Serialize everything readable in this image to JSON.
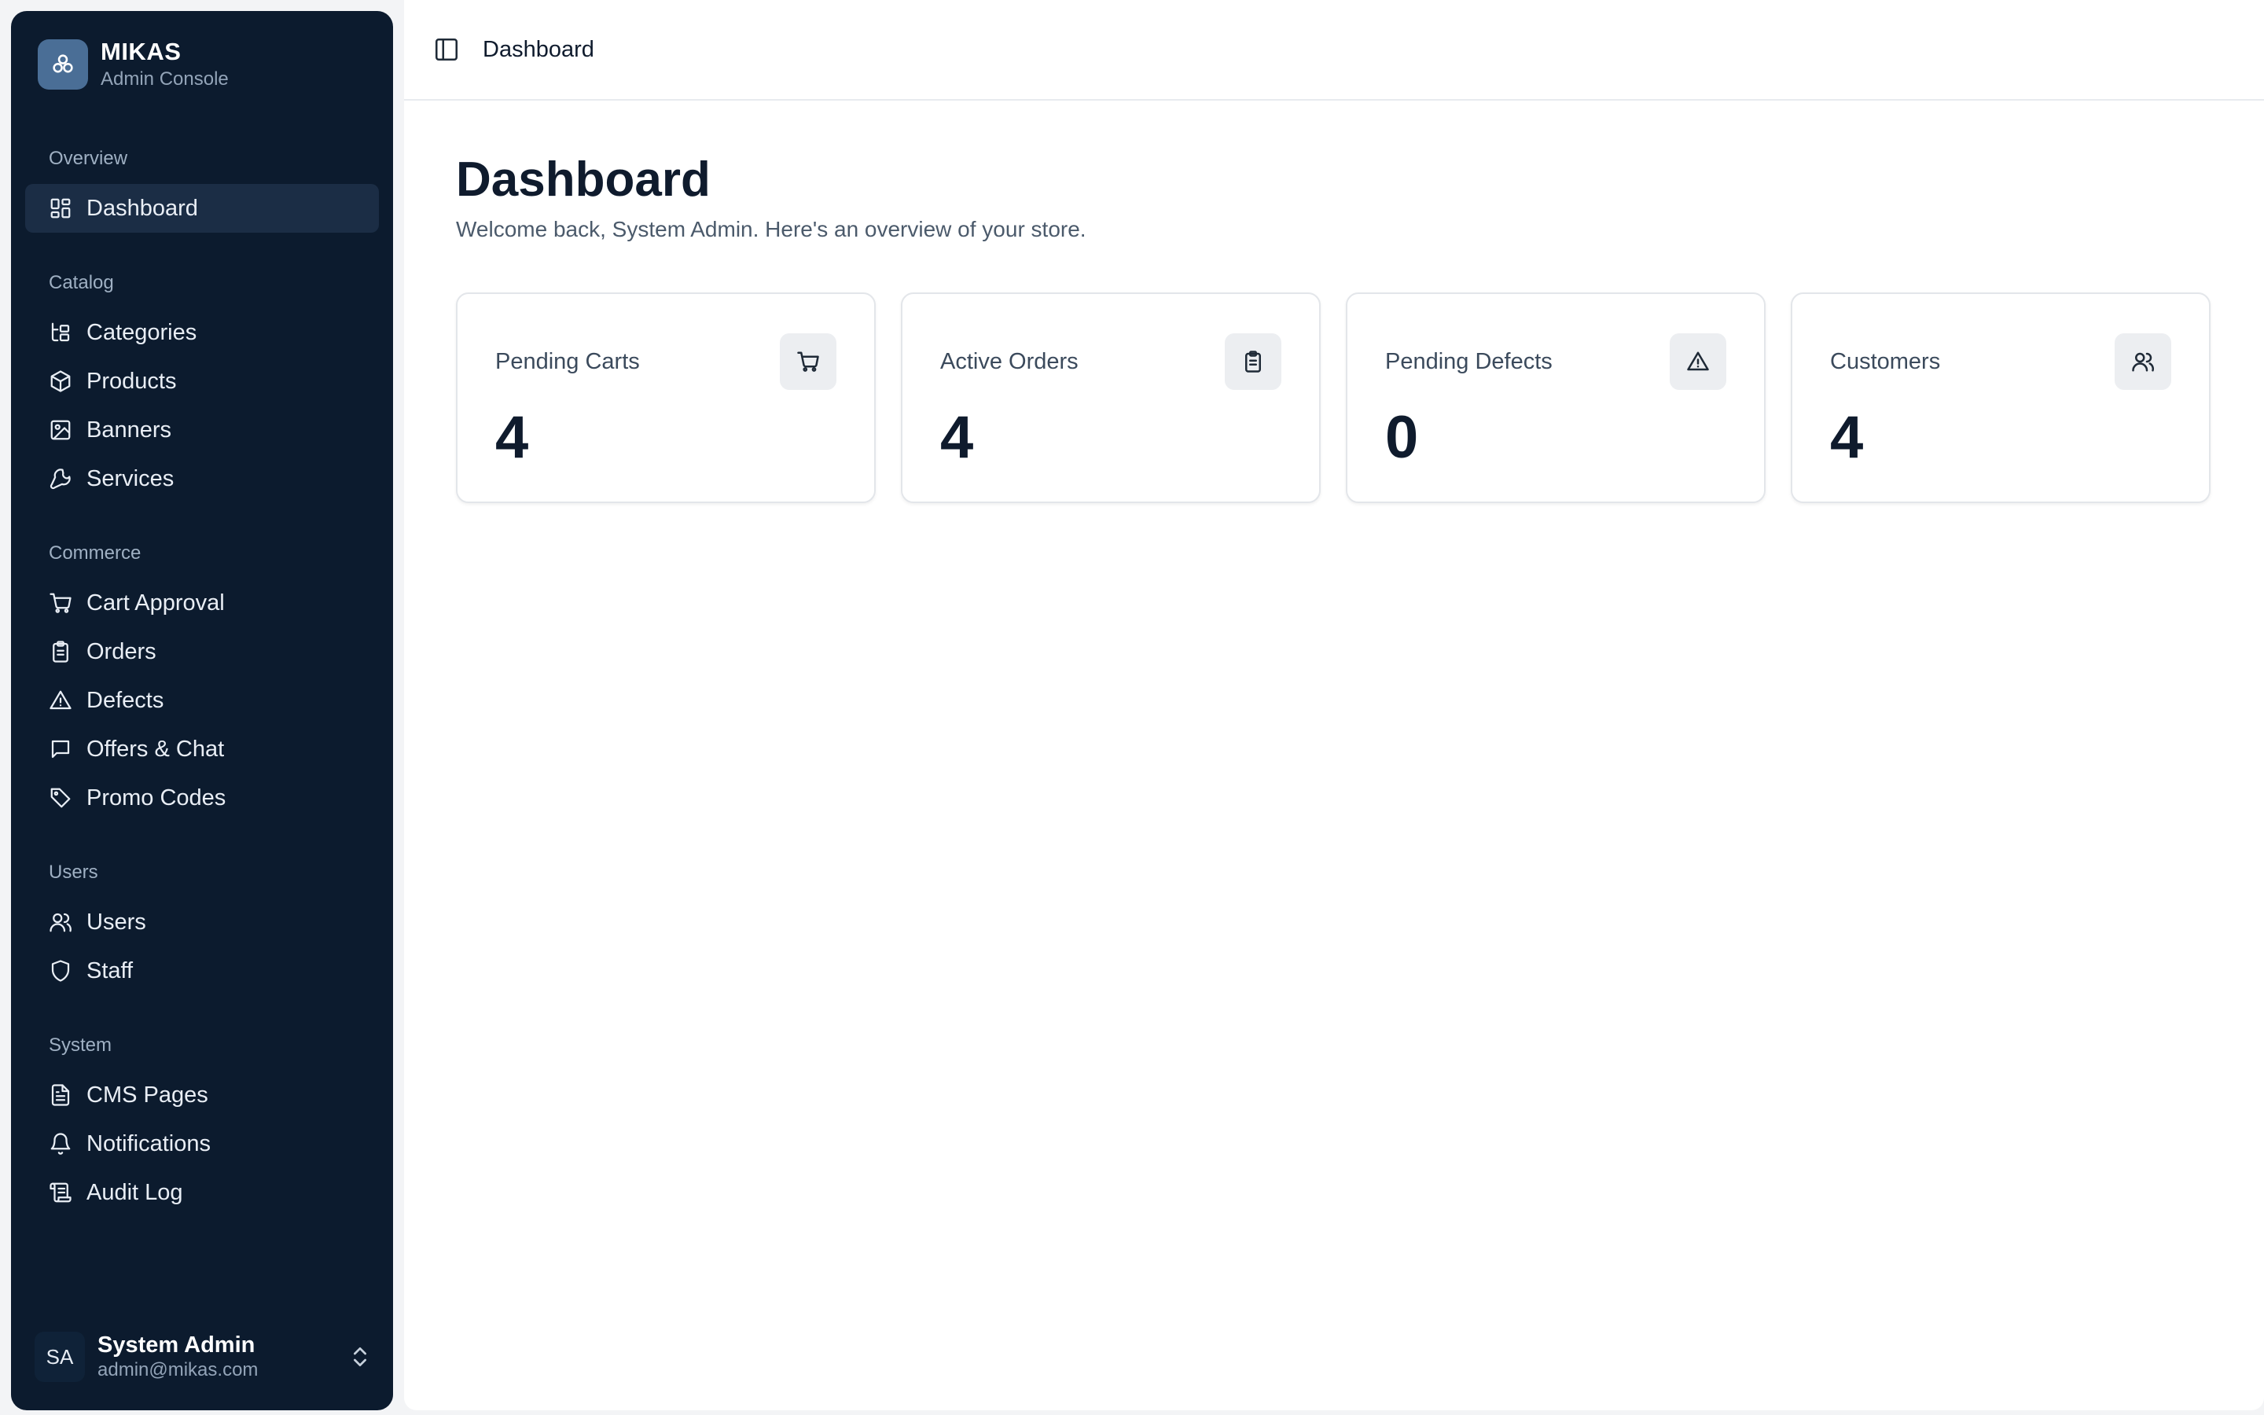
{
  "brand": {
    "name": "MIKAS",
    "subtitle": "Admin Console"
  },
  "sidebar": {
    "sections": [
      {
        "label": "Overview",
        "items": [
          {
            "label": "Dashboard",
            "icon": "dashboard-icon",
            "active": true
          }
        ]
      },
      {
        "label": "Catalog",
        "items": [
          {
            "label": "Categories",
            "icon": "categories-icon"
          },
          {
            "label": "Products",
            "icon": "package-icon"
          },
          {
            "label": "Banners",
            "icon": "image-icon"
          },
          {
            "label": "Services",
            "icon": "wrench-icon"
          }
        ]
      },
      {
        "label": "Commerce",
        "items": [
          {
            "label": "Cart Approval",
            "icon": "cart-icon"
          },
          {
            "label": "Orders",
            "icon": "clipboard-icon"
          },
          {
            "label": "Defects",
            "icon": "warning-icon"
          },
          {
            "label": "Offers & Chat",
            "icon": "chat-icon"
          },
          {
            "label": "Promo Codes",
            "icon": "tag-icon"
          }
        ]
      },
      {
        "label": "Users",
        "items": [
          {
            "label": "Users",
            "icon": "users-icon"
          },
          {
            "label": "Staff",
            "icon": "shield-icon"
          }
        ]
      },
      {
        "label": "System",
        "items": [
          {
            "label": "CMS Pages",
            "icon": "document-icon"
          },
          {
            "label": "Notifications",
            "icon": "bell-icon"
          },
          {
            "label": "Audit Log",
            "icon": "scroll-icon"
          }
        ]
      }
    ]
  },
  "user": {
    "initials": "SA",
    "name": "System Admin",
    "email": "admin@mikas.com"
  },
  "header": {
    "breadcrumb": "Dashboard"
  },
  "main": {
    "title": "Dashboard",
    "subtitle": "Welcome back, System Admin. Here's an overview of your store.",
    "cards": [
      {
        "label": "Pending Carts",
        "value": "4",
        "icon": "cart-icon"
      },
      {
        "label": "Active Orders",
        "value": "4",
        "icon": "clipboard-icon"
      },
      {
        "label": "Pending Defects",
        "value": "0",
        "icon": "warning-icon"
      },
      {
        "label": "Customers",
        "value": "4",
        "icon": "users-icon"
      }
    ]
  },
  "colors": {
    "sidebar_bg": "#0c1b2e",
    "active_item_bg": "#1b2d45",
    "logo_bg": "#4a6e96"
  }
}
